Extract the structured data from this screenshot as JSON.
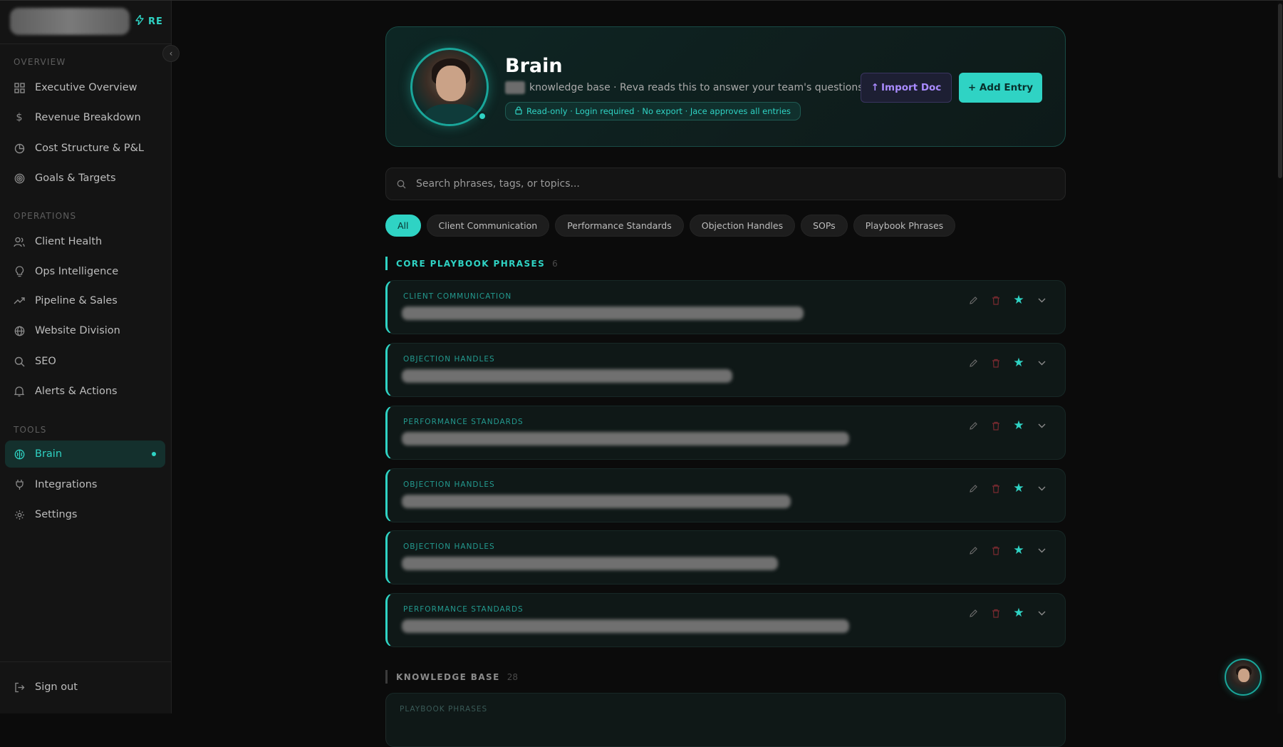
{
  "sidebar": {
    "logo_badge": "RE",
    "collapse_icon": "chevron-left-icon",
    "sections": [
      {
        "title": "OVERVIEW",
        "items": [
          {
            "label": "Executive Overview",
            "icon": "grid-icon"
          },
          {
            "label": "Revenue Breakdown",
            "icon": "dollar-icon"
          },
          {
            "label": "Cost Structure & P&L",
            "icon": "pie-chart-icon"
          },
          {
            "label": "Goals & Targets",
            "icon": "target-icon"
          }
        ]
      },
      {
        "title": "OPERATIONS",
        "items": [
          {
            "label": "Client Health",
            "icon": "users-icon"
          },
          {
            "label": "Ops Intelligence",
            "icon": "lightbulb-icon"
          },
          {
            "label": "Pipeline & Sales",
            "icon": "trending-up-icon"
          },
          {
            "label": "Website Division",
            "icon": "globe-icon"
          },
          {
            "label": "SEO",
            "icon": "search-icon"
          },
          {
            "label": "Alerts & Actions",
            "icon": "bell-icon"
          }
        ]
      },
      {
        "title": "TOOLS",
        "items": [
          {
            "label": "Brain",
            "icon": "brain-icon",
            "active": true
          },
          {
            "label": "Integrations",
            "icon": "plug-icon"
          },
          {
            "label": "Settings",
            "icon": "gear-icon"
          }
        ]
      }
    ],
    "sign_out": "Sign out"
  },
  "hero": {
    "title": "Brain",
    "subtitle": "knowledge base · Reva reads this to answer your team's questions",
    "pill": "Read-only · Login required · No export · Jace approves all entries",
    "import_button": "Import Doc",
    "add_button": "+ Add Entry"
  },
  "search": {
    "placeholder": "Search phrases, tags, or topics..."
  },
  "filters": [
    "All",
    "Client Communication",
    "Performance Standards",
    "Objection Handles",
    "SOPs",
    "Playbook Phrases"
  ],
  "core_section": {
    "label": "CORE PLAYBOOK PHRASES",
    "count": "6",
    "cards": [
      {
        "category": "CLIENT COMMUNICATION",
        "text_fraction": 0.62
      },
      {
        "category": "OBJECTION HANDLES",
        "text_fraction": 0.51
      },
      {
        "category": "PERFORMANCE STANDARDS",
        "text_fraction": 0.69
      },
      {
        "category": "OBJECTION HANDLES",
        "text_fraction": 0.6
      },
      {
        "category": "OBJECTION HANDLES",
        "text_fraction": 0.58
      },
      {
        "category": "PERFORMANCE STANDARDS",
        "text_fraction": 0.69
      }
    ]
  },
  "kb_section": {
    "label": "KNOWLEDGE BASE",
    "count": "28",
    "first_card_category": "PLAYBOOK PHRASES"
  },
  "colors": {
    "accent": "#2fd3c4",
    "import_accent": "#a98bff",
    "danger": "#6a2a2e"
  }
}
